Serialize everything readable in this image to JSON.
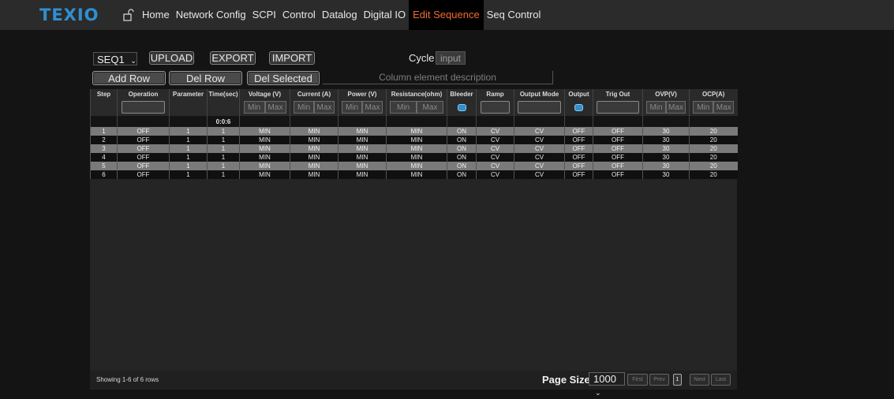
{
  "brand": "TEXIO",
  "nav": [
    "Home",
    "Network Config",
    "SCPI",
    "Control",
    "Datalog",
    "Digital IO",
    "Edit Sequence",
    "Seq Control"
  ],
  "active_nav": "Edit Sequence",
  "accent": "#f26a2e",
  "toolbar": {
    "sequence": "SEQ1",
    "upload": "UPLOAD",
    "export": "EXPORT",
    "import": "IMPORT",
    "cycle_label": "Cycle",
    "cycle_placeholder": "input",
    "add_row": "Add Row",
    "del_row": "Del Row",
    "del_selected": "Del Selected",
    "column_desc": "Column element description"
  },
  "table": {
    "headers": [
      "Step",
      "Operation",
      "Parameter",
      "Time(sec)",
      "Voltage (V)",
      "Current (A)",
      "Power (V)",
      "Resistance(ohm)",
      "Bleeder",
      "Ramp",
      "Output Mode",
      "Output",
      "Trig Out",
      "OVP(V)",
      "OCP(A)"
    ],
    "min": "Min",
    "max": "Max",
    "total_time": "0:0:6",
    "rows": [
      [
        "1",
        "OFF",
        "1",
        "1",
        "MIN",
        "MIN",
        "MIN",
        "MIN",
        "ON",
        "CV",
        "CV",
        "OFF",
        "OFF",
        "30",
        "20"
      ],
      [
        "2",
        "OFF",
        "1",
        "1",
        "MIN",
        "MIN",
        "MIN",
        "MIN",
        "ON",
        "CV",
        "CV",
        "OFF",
        "OFF",
        "30",
        "20"
      ],
      [
        "3",
        "OFF",
        "1",
        "1",
        "MIN",
        "MIN",
        "MIN",
        "MIN",
        "ON",
        "CV",
        "CV",
        "OFF",
        "OFF",
        "30",
        "20"
      ],
      [
        "4",
        "OFF",
        "1",
        "1",
        "MIN",
        "MIN",
        "MIN",
        "MIN",
        "ON",
        "CV",
        "CV",
        "OFF",
        "OFF",
        "30",
        "20"
      ],
      [
        "5",
        "OFF",
        "1",
        "1",
        "MIN",
        "MIN",
        "MIN",
        "MIN",
        "ON",
        "CV",
        "CV",
        "OFF",
        "OFF",
        "30",
        "20"
      ],
      [
        "6",
        "OFF",
        "1",
        "1",
        "MIN",
        "MIN",
        "MIN",
        "MIN",
        "ON",
        "CV",
        "CV",
        "OFF",
        "OFF",
        "30",
        "20"
      ]
    ]
  },
  "footer": {
    "showing": "Showing 1-6 of 6 rows",
    "page_size_label": "Page Size",
    "page_size": "1000",
    "first": "First",
    "prev": "Prev",
    "page": "1",
    "next": "Next",
    "last": "Last"
  }
}
